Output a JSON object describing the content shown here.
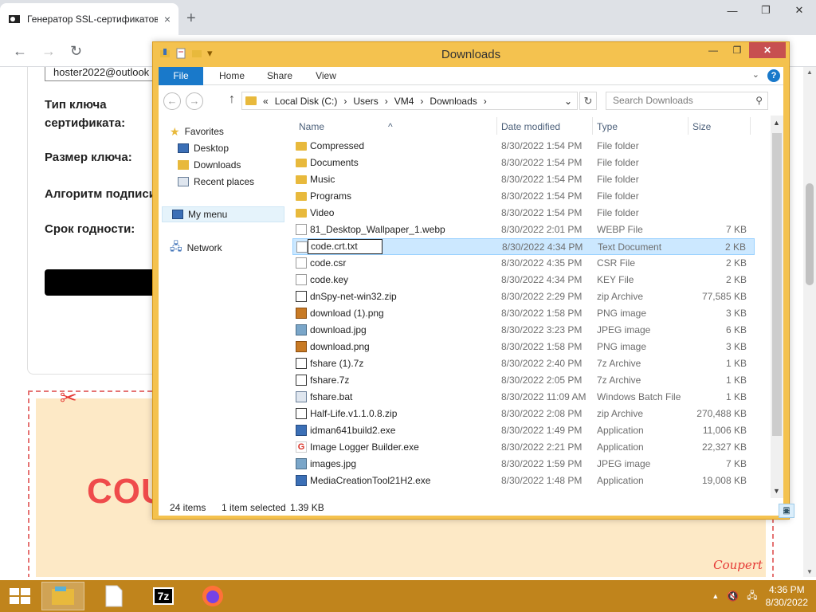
{
  "browser": {
    "tab_title": "Генератор SSL-сертификатов",
    "tab_close": "×",
    "new_tab": "+",
    "win_minimize": "—",
    "win_restore": "❐",
    "win_close": "✕",
    "nav_back": "←",
    "nav_forward": "→",
    "nav_reload": "↻"
  },
  "webpage": {
    "email_value": "hoster2022@outlook",
    "labels": {
      "key_type": "Тип ключа сертификата:",
      "key_size": "Размер ключа:",
      "sign_algo": "Алгоритм подписи",
      "validity": "Срок годности:"
    },
    "coupon_text": "COU",
    "scissors": "✂",
    "brand": "Coupert"
  },
  "explorer": {
    "title": "Downloads",
    "quick_access": [
      "▾"
    ],
    "win_minimize": "—",
    "win_restore": "❐",
    "win_close": "✕",
    "ribbon_tabs": [
      "File",
      "Home",
      "Share",
      "View"
    ],
    "ribbon_chevron": "⌄",
    "help": "?",
    "nav_back": "←",
    "nav_forward": "→",
    "nav_up": "↑",
    "breadcrumb": [
      "«",
      "Local Disk (C:)",
      "›",
      "Users",
      "›",
      "VM4",
      "›",
      "Downloads",
      "›"
    ],
    "address_dropdown": "⌄",
    "refresh": "↻",
    "search_placeholder": "Search Downloads",
    "search_icon": "⚲",
    "nav_pane": {
      "favorites": "Favorites",
      "desktop": "Desktop",
      "downloads": "Downloads",
      "recent": "Recent places",
      "mymenu": "My menu",
      "network": "Network"
    },
    "columns": {
      "name": "Name",
      "date": "Date modified",
      "type": "Type",
      "size": "Size"
    },
    "files": [
      {
        "name": "Compressed",
        "date": "8/30/2022 1:54 PM",
        "type": "File folder",
        "size": "",
        "icon": "folder"
      },
      {
        "name": "Documents",
        "date": "8/30/2022 1:54 PM",
        "type": "File folder",
        "size": "",
        "icon": "folder"
      },
      {
        "name": "Music",
        "date": "8/30/2022 1:54 PM",
        "type": "File folder",
        "size": "",
        "icon": "folder"
      },
      {
        "name": "Programs",
        "date": "8/30/2022 1:54 PM",
        "type": "File folder",
        "size": "",
        "icon": "folder"
      },
      {
        "name": "Video",
        "date": "8/30/2022 1:54 PM",
        "type": "File folder",
        "size": "",
        "icon": "folder"
      },
      {
        "name": "81_Desktop_Wallpaper_1.webp",
        "date": "8/30/2022 2:01 PM",
        "type": "WEBP File",
        "size": "7 KB",
        "icon": "doc"
      },
      {
        "name": "code.crt.txt",
        "date": "8/30/2022 4:34 PM",
        "type": "Text Document",
        "size": "2 KB",
        "icon": "doc"
      },
      {
        "name": "code.csr",
        "date": "8/30/2022 4:35 PM",
        "type": "CSR File",
        "size": "2 KB",
        "icon": "doc"
      },
      {
        "name": "code.key",
        "date": "8/30/2022 4:34 PM",
        "type": "KEY File",
        "size": "2 KB",
        "icon": "doc"
      },
      {
        "name": "dnSpy-net-win32.zip",
        "date": "8/30/2022 2:29 PM",
        "type": "zip Archive",
        "size": "77,585 KB",
        "icon": "zip"
      },
      {
        "name": "download (1).png",
        "date": "8/30/2022 1:58 PM",
        "type": "PNG image",
        "size": "3 KB",
        "icon": "png"
      },
      {
        "name": "download.jpg",
        "date": "8/30/2022 3:23 PM",
        "type": "JPEG image",
        "size": "6 KB",
        "icon": "img"
      },
      {
        "name": "download.png",
        "date": "8/30/2022 1:58 PM",
        "type": "PNG image",
        "size": "3 KB",
        "icon": "png"
      },
      {
        "name": "fshare (1).7z",
        "date": "8/30/2022 2:40 PM",
        "type": "7z Archive",
        "size": "1 KB",
        "icon": "zip"
      },
      {
        "name": "fshare.7z",
        "date": "8/30/2022 2:05 PM",
        "type": "7z Archive",
        "size": "1 KB",
        "icon": "zip"
      },
      {
        "name": "fshare.bat",
        "date": "8/30/2022 11:09 AM",
        "type": "Windows Batch File",
        "size": "1 KB",
        "icon": "bat"
      },
      {
        "name": "Half-Life.v1.1.0.8.zip",
        "date": "8/30/2022 2:08 PM",
        "type": "zip Archive",
        "size": "270,488 KB",
        "icon": "zip"
      },
      {
        "name": "idman641build2.exe",
        "date": "8/30/2022 1:49 PM",
        "type": "Application",
        "size": "11,006 KB",
        "icon": "exe"
      },
      {
        "name": "Image Logger Builder.exe",
        "date": "8/30/2022 2:21 PM",
        "type": "Application",
        "size": "22,327 KB",
        "icon": "g"
      },
      {
        "name": "images.jpg",
        "date": "8/30/2022 1:59 PM",
        "type": "JPEG image",
        "size": "7 KB",
        "icon": "img"
      },
      {
        "name": "MediaCreationTool21H2.exe",
        "date": "8/30/2022 1:48 PM",
        "type": "Application",
        "size": "19,008 KB",
        "icon": "exe"
      }
    ],
    "rename_value": "code.crt.txt",
    "status": {
      "count": "24 items",
      "selection": "1 item selected",
      "size": "1.39 KB"
    }
  },
  "taskbar": {
    "clock_time": "4:36 PM",
    "clock_date": "8/30/2022",
    "app_7z": "7z",
    "tray_arrow": "▲"
  }
}
